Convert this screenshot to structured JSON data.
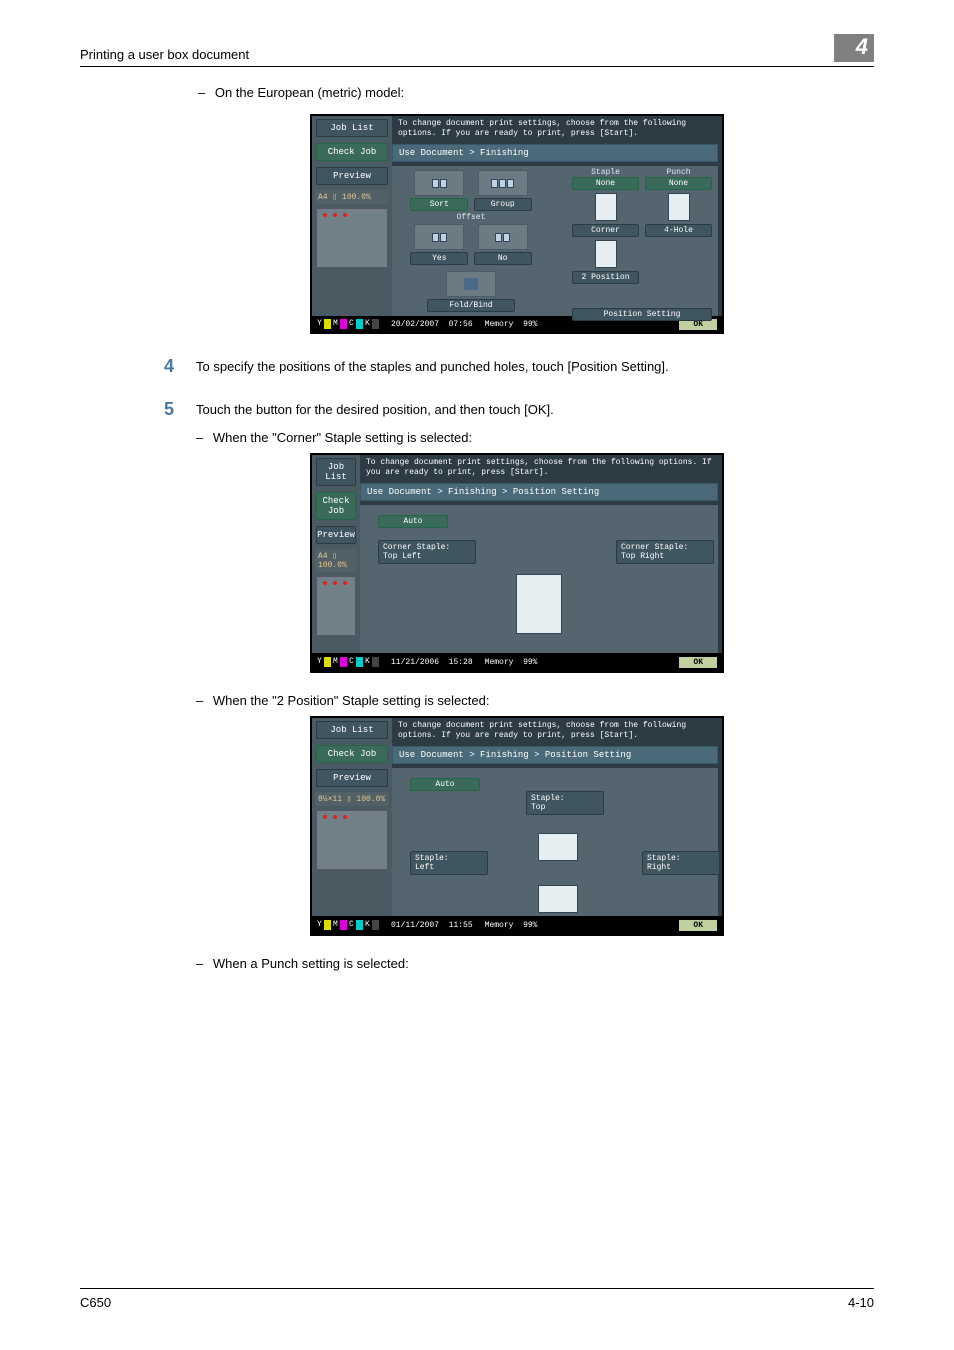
{
  "header": {
    "title": "Printing a user box document",
    "section_number": "4"
  },
  "bullets": {
    "b1": "On the European (metric) model:",
    "b2": "When the \"Corner\" Staple setting is selected:",
    "b3": "When the \"2 Position\" Staple setting is selected:",
    "b4": "When a Punch setting is selected:"
  },
  "steps": {
    "s4_num": "4",
    "s4_text": "To specify the positions of the staples and punched holes, touch [Position Setting].",
    "s5_num": "5",
    "s5_text": "Touch the button for the desired position, and then touch [OK]."
  },
  "panel_shared": {
    "job_list": "Job List",
    "check_job": "Check Job",
    "preview": "Preview",
    "msg": "To change document print settings, choose from the following options. If you are ready to print, press [Start].",
    "ok": "OK",
    "memory": "Memory"
  },
  "panel1": {
    "left_tab": "A4 ▯  100.0%",
    "breadcrumb": "Use Document > Finishing",
    "sort": "Sort",
    "group": "Group",
    "offset": "Offset",
    "yes": "Yes",
    "no": "No",
    "foldbind": "Fold/Bind",
    "staple": "Staple",
    "punch": "Punch",
    "none": "None",
    "corner": "Corner",
    "fourhole": "4-Hole",
    "twopos": "2 Position",
    "possetting": "Position Setting",
    "date": "20/02/2007",
    "time": "07:56",
    "mem": "99%"
  },
  "panel2": {
    "left_tab": "A4 ▯  100.0%",
    "breadcrumb": "Use Document > Finishing > Position Setting",
    "auto": "Auto",
    "topleft": "Corner Staple:\nTop Left",
    "topright": "Corner Staple:\nTop Right",
    "date": "11/21/2006",
    "time": "15:28",
    "mem": "99%"
  },
  "panel3": {
    "left_tab": "8½×11 ▯  100.0%",
    "breadcrumb": "Use Document > Finishing > Position Setting",
    "auto": "Auto",
    "top": "Staple:\nTop",
    "left": "Staple:\nLeft",
    "right": "Staple:\nRight",
    "date": "01/11/2007",
    "time": "11:55",
    "mem": "99%"
  },
  "footer": {
    "left": "C650",
    "right": "4-10"
  }
}
